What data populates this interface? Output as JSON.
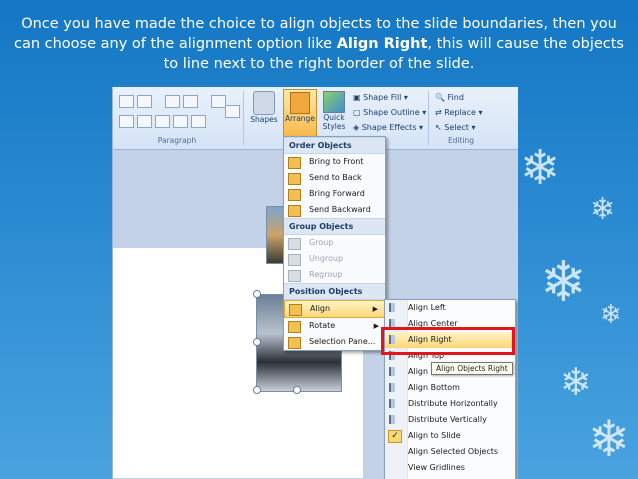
{
  "caption": {
    "part1": "Once you have made the choice to align objects to the slide boundaries, then you can choose any of the alignment option like ",
    "bold": "Align Right",
    "part2": ", this will cause the objects to line next to the right border of the slide."
  },
  "ribbon": {
    "paragraph_label": "Paragraph",
    "editing_label": "Editing",
    "shapes_label": "Shapes",
    "arrange_label": "Arrange",
    "quick_styles_label": "Quick Styles",
    "shape_fill": "Shape Fill",
    "shape_outline": "Shape Outline",
    "shape_effects": "Shape Effects",
    "find": "Find",
    "replace": "Replace",
    "select": "Select"
  },
  "arrange_menu": {
    "order_header": "Order Objects",
    "order_items": [
      "Bring to Front",
      "Send to Back",
      "Bring Forward",
      "Send Backward"
    ],
    "group_header": "Group Objects",
    "group_items": [
      "Group",
      "Ungroup",
      "Regroup"
    ],
    "position_header": "Position Objects",
    "position_items": [
      "Align",
      "Rotate",
      "Selection Pane..."
    ]
  },
  "align_submenu": {
    "items": [
      "Align Left",
      "Align Center",
      "Align Right",
      "Align Top",
      "Align Middle",
      "Align Bottom",
      "Distribute Horizontally",
      "Distribute Vertically",
      "Align to Slide",
      "Align Selected Objects",
      "View Gridlines"
    ],
    "tooltip": "Align Objects Right"
  },
  "colors": {
    "highlight": "#fbd876",
    "red_box": "#e3141b"
  }
}
